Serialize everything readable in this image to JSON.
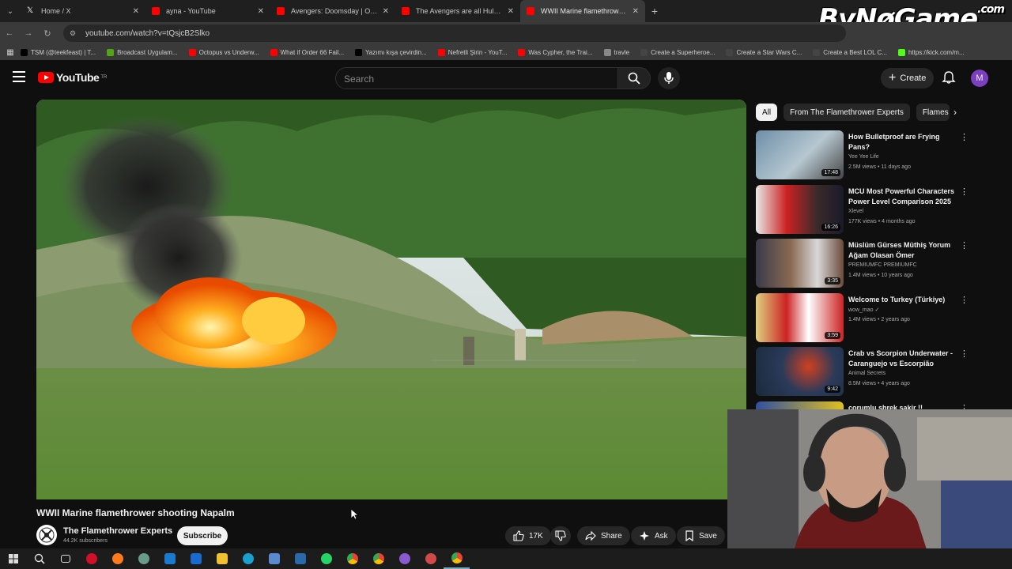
{
  "browser": {
    "tabs": [
      {
        "title": "Home / X",
        "color": "#000000"
      },
      {
        "title": "ayna - YouTube",
        "color": "#ff0000"
      },
      {
        "title": "Avengers: Doomsday | Only in",
        "color": "#ff0000"
      },
      {
        "title": "The Avengers are all Hulks? | M",
        "color": "#ff0000"
      },
      {
        "title": "WWII Marine flamethrower sho",
        "color": "#ff0000",
        "active": true
      }
    ],
    "url": "youtube.com/watch?v=tQsjcB2Slko",
    "bookmarks": [
      {
        "label": "TSM (@teekfeast) | T...",
        "color": "#000000"
      },
      {
        "label": "Broadcast Uygulam...",
        "color": "#53a318"
      },
      {
        "label": "Octopus vs Underw...",
        "color": "#ff0000"
      },
      {
        "label": "What if Order 66 Fail...",
        "color": "#ff0000"
      },
      {
        "label": "Yazımı kışa çevirdin...",
        "color": "#000000"
      },
      {
        "label": "Nefretli Şirin - YouT...",
        "color": "#ff0000"
      },
      {
        "label": "Was Cypher, the Trai...",
        "color": "#ff0000"
      },
      {
        "label": "travle",
        "color": "#888888"
      },
      {
        "label": "Create a Superheroe...",
        "color": "#444444"
      },
      {
        "label": "Create a Star Wars C...",
        "color": "#444444"
      },
      {
        "label": "Create a Best LOL C...",
        "color": "#444444"
      },
      {
        "label": "https://kick.com/m...",
        "color": "#53fc18"
      }
    ],
    "watermark": "ByNøGame",
    "watermark_suffix": ".com"
  },
  "header": {
    "logo_text": "YouTube",
    "country_code": "TR",
    "search_placeholder": "Search",
    "create_label": "Create",
    "avatar_letter": "M",
    "brand_color": "#ff0000"
  },
  "video": {
    "title": "WWII Marine flamethrower shooting Napalm",
    "channel": "The Flamethrower Experts",
    "subscribers": "44.2K subscribers",
    "subscribe_label": "Subscribe",
    "likes": "17K",
    "share_label": "Share",
    "ask_label": "Ask",
    "save_label": "Save"
  },
  "sidebar": {
    "chips": [
      "All",
      "From The Flamethrower Experts",
      "Flames"
    ],
    "recommendations": [
      {
        "title": "How Bulletproof are Frying Pans?",
        "channel": "Yee Yee Life",
        "meta": "2.5M views • 11 days ago",
        "duration": "17:48"
      },
      {
        "title": "MCU Most Powerful Characters Power Level Comparison 2025",
        "channel": "Xlevel",
        "meta": "177K views • 4 months ago",
        "duration": "16:26"
      },
      {
        "title": "Müslüm Gürses Müthiş Yorum Ağam Olasan Ömer",
        "channel": "PREMIUMFC PREMIUMFC",
        "meta": "1.4M views • 10 years ago",
        "duration": "3:35"
      },
      {
        "title": "Welcome to Turkey (Türkiye)",
        "channel": "wow_mao",
        "meta": "1.4M views • 2 years ago",
        "duration": "3:59"
      },
      {
        "title": "Crab vs Scorpion Underwater - Caranguejo vs Escorpião",
        "channel": "Animal Secrets",
        "meta": "8.5M views • 4 years ago",
        "duration": "9:42"
      },
      {
        "title": "çorumlu şhrek şakir !!",
        "channel": "",
        "meta": "",
        "duration": ""
      }
    ]
  }
}
